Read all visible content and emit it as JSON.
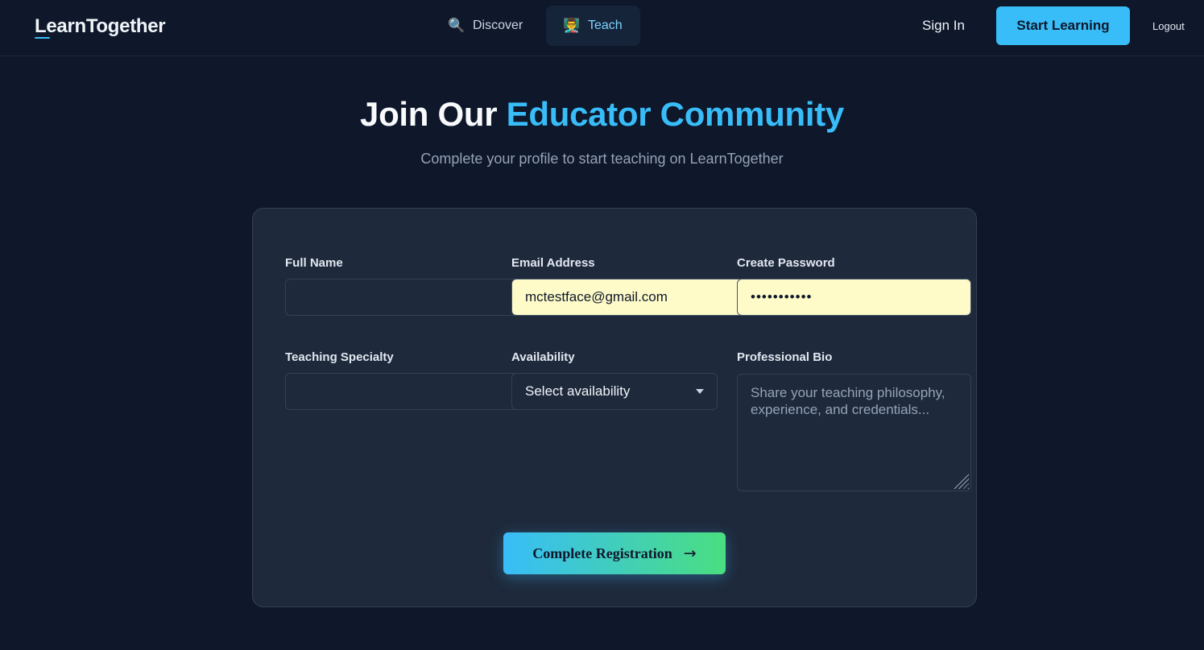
{
  "header": {
    "logo": "LearnTogether",
    "nav": [
      {
        "icon": "magnifier-icon",
        "glyph": "🔍",
        "label": "Discover"
      },
      {
        "icon": "teacher-icon",
        "glyph": "👨‍🏫",
        "label": "Teach"
      }
    ],
    "sign_in": "Sign In",
    "start_learning": "Start Learning",
    "logout": "Logout"
  },
  "hero": {
    "title_part1": "Join Our ",
    "title_accent": "Educator Community",
    "subtitle": "Complete your profile to start teaching on LearnTogether"
  },
  "form": {
    "full_name": {
      "label": "Full Name",
      "value": ""
    },
    "email": {
      "label": "Email Address",
      "value": "mctestface@gmail.com"
    },
    "password": {
      "label": "Create Password",
      "value": "•••••••••••"
    },
    "specialty": {
      "label": "Teaching Specialty",
      "value": ""
    },
    "availability": {
      "label": "Availability",
      "selected": "Select availability"
    },
    "bio": {
      "label": "Professional Bio",
      "placeholder": "Share your teaching philosophy, experience, and credentials..."
    },
    "submit_label": "Complete Registration",
    "submit_arrow": "→"
  },
  "colors": {
    "background": "#0f172a",
    "card": "#1e293b",
    "accent": "#38bdf8",
    "gradient_end": "#4ade80",
    "autofill": "#fefbc8"
  }
}
